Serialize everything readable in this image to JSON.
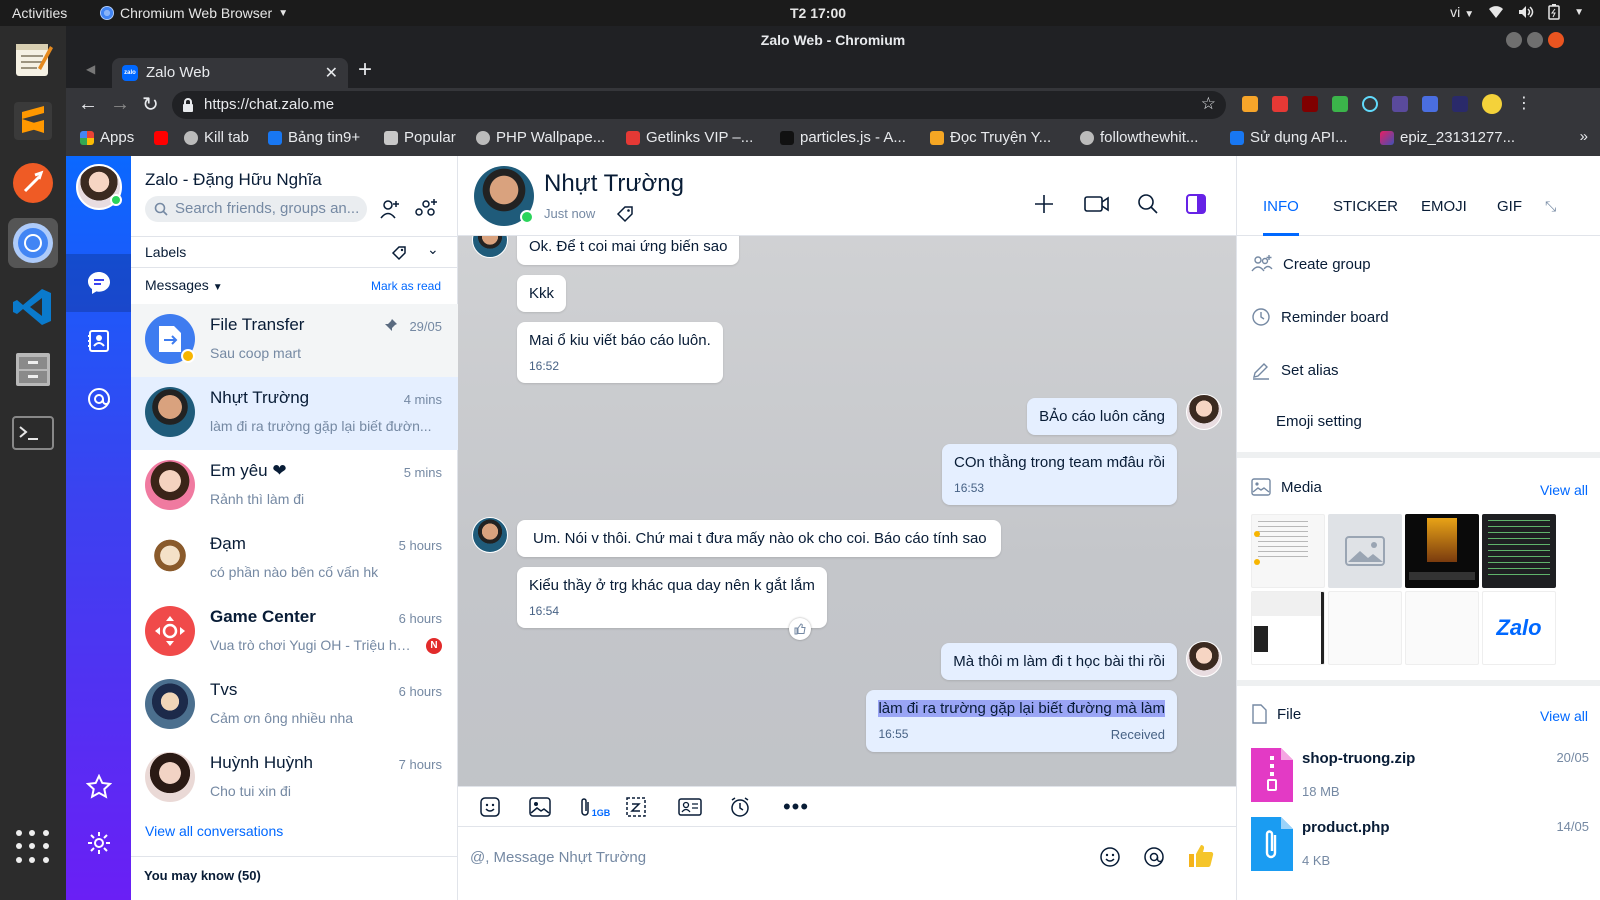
{
  "os": {
    "activities": "Activities",
    "app_name": "Chromium Web Browser",
    "clock": "T2 17:00",
    "lang": "vi"
  },
  "browser": {
    "window_title": "Zalo Web - Chromium",
    "tab_title": "Zalo Web",
    "url": "https://chat.zalo.me",
    "bookmarks": [
      "Apps",
      "Kill tab",
      "Bảng tin9+",
      "Popular",
      "PHP Wallpape...",
      "Getlinks VIP –...",
      "particles.js - A...",
      "Đọc Truyện Y...",
      "followthewhit...",
      "Sử dụng API...",
      "epiz_23131277..."
    ]
  },
  "sidebar": {
    "title": "Zalo - Đặng Hữu Nghĩa",
    "search_placeholder": "Search friends, groups an...",
    "labels": "Labels",
    "messages_filter": "Messages",
    "mark_as_read": "Mark as read",
    "view_all": "View all conversations",
    "you_may_know": "You may know (50)",
    "conversations": [
      {
        "name": "File Transfer",
        "preview": "Sau coop mart",
        "time": "29/05",
        "pinned": true
      },
      {
        "name": "Nhựt Trường",
        "preview": "làm đi ra trường gặp lại biết đườn...",
        "time": "4 mins"
      },
      {
        "name": "Em yêu ❤",
        "preview": "Rảnh thì làm đi",
        "time": "5 mins"
      },
      {
        "name": "Đạm",
        "preview": "có phần nào bên cố vấn hk",
        "time": "5 hours"
      },
      {
        "name": "Game Center",
        "preview": "Vua trò chơi Yugi OH - Triệu hồi...",
        "time": "6 hours",
        "badge": "N"
      },
      {
        "name": "Tvs",
        "preview": "Cảm ơn ông nhiều nha",
        "time": "6 hours"
      },
      {
        "name": "Huỳnh Huỳnh",
        "preview": "Cho tui xin đi",
        "time": "7 hours"
      }
    ]
  },
  "chat": {
    "contact_name": "Nhựt Trường",
    "status": "Just now",
    "input_placeholder": "@, Message Nhựt Trường",
    "attach_limit": "1GB",
    "messages": [
      {
        "from": "them",
        "text": "Ok. Để t coi mai ứng biến sao"
      },
      {
        "from": "them",
        "text": "Kkk"
      },
      {
        "from": "them",
        "text": "Mai ổ kiu viết báo cáo luôn.",
        "time": "16:52"
      },
      {
        "from": "me",
        "text": "BẢo cáo luôn căng"
      },
      {
        "from": "me",
        "text": "COn thằng trong team  mđâu rồi",
        "time": "16:53"
      },
      {
        "from": "them",
        "text": "Um. Nói v thôi. Chứ mai t đưa mấy nào ok cho coi. Báo cáo tính sao"
      },
      {
        "from": "them",
        "text": "Kiểu thầy ở trg khác qua day nên k gắt lắm",
        "time": "16:54"
      },
      {
        "from": "me",
        "text": "Mà thôi m làm đi t học bài thi rồi"
      },
      {
        "from": "me",
        "text": "làm đi ra trường gặp lại biết đường mà làm",
        "time": "16:55",
        "status": "Received"
      }
    ]
  },
  "info_panel": {
    "tabs": [
      "INFO",
      "STICKER",
      "EMOJI",
      "GIF"
    ],
    "active_tab": "INFO",
    "actions": [
      "Create group",
      "Reminder board",
      "Set alias",
      "Emoji setting"
    ],
    "media_title": "Media",
    "media_view_all": "View all",
    "file_title": "File",
    "file_view_all": "View all",
    "thumb_logo": "Zalo",
    "files": [
      {
        "name": "shop-truong.zip",
        "size": "18 MB",
        "date": "20/05"
      },
      {
        "name": "product.php",
        "size": "4 KB",
        "date": "14/05"
      }
    ]
  },
  "colors": {
    "accent": "#0068ff",
    "purple": "#6622e6",
    "my_bubble": "#e5efff",
    "selection": "#9aa5f5"
  }
}
